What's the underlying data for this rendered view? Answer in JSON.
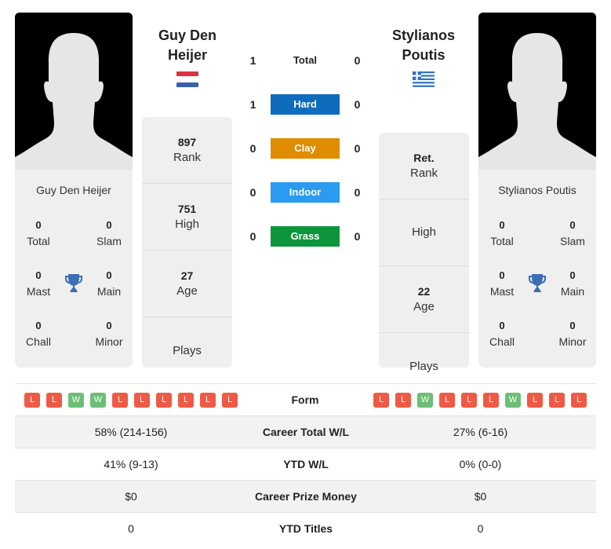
{
  "player1": {
    "name_line1": "Guy Den",
    "name_line2": "Heijer",
    "full_name": "Guy Den Heijer",
    "country_flag": "netherlands-flag",
    "info": [
      {
        "value": "897",
        "label": "Rank"
      },
      {
        "value": "751",
        "label": "High"
      },
      {
        "value": "27",
        "label": "Age"
      },
      {
        "value": "",
        "label": "Plays"
      }
    ],
    "titles": {
      "total": {
        "value": "0",
        "label": "Total"
      },
      "slam": {
        "value": "0",
        "label": "Slam"
      },
      "mast": {
        "value": "0",
        "label": "Mast"
      },
      "main": {
        "value": "0",
        "label": "Main"
      },
      "chall": {
        "value": "0",
        "label": "Chall"
      },
      "minor": {
        "value": "0",
        "label": "Minor"
      }
    },
    "form": [
      "L",
      "L",
      "W",
      "W",
      "L",
      "L",
      "L",
      "L",
      "L",
      "L"
    ]
  },
  "player2": {
    "name_line1": "Stylianos",
    "name_line2": "Poutis",
    "full_name": "Stylianos Poutis",
    "country_flag": "greece-flag",
    "info": [
      {
        "value": "Ret.",
        "label": "Rank"
      },
      {
        "value": "",
        "label": "High"
      },
      {
        "value": "22",
        "label": "Age"
      },
      {
        "value": "",
        "label": "Plays"
      }
    ],
    "titles": {
      "total": {
        "value": "0",
        "label": "Total"
      },
      "slam": {
        "value": "0",
        "label": "Slam"
      },
      "mast": {
        "value": "0",
        "label": "Mast"
      },
      "main": {
        "value": "0",
        "label": "Main"
      },
      "chall": {
        "value": "0",
        "label": "Chall"
      },
      "minor": {
        "value": "0",
        "label": "Minor"
      }
    },
    "form": [
      "L",
      "L",
      "W",
      "L",
      "L",
      "L",
      "W",
      "L",
      "L",
      "L"
    ]
  },
  "h2h": [
    {
      "label": "Total",
      "p1": "1",
      "p2": "0",
      "color": ""
    },
    {
      "label": "Hard",
      "p1": "1",
      "p2": "0",
      "color": "#0f6cbd"
    },
    {
      "label": "Clay",
      "p1": "0",
      "p2": "0",
      "color": "#df8c00"
    },
    {
      "label": "Indoor",
      "p1": "0",
      "p2": "0",
      "color": "#2a9bf0"
    },
    {
      "label": "Grass",
      "p1": "0",
      "p2": "0",
      "color": "#0d953b"
    }
  ],
  "form_label": "Form",
  "stats": [
    {
      "label": "Career Total W/L",
      "p1": "58% (214-156)",
      "p2": "27% (6-16)"
    },
    {
      "label": "YTD W/L",
      "p1": "41% (9-13)",
      "p2": "0% (0-0)"
    },
    {
      "label": "Career Prize Money",
      "p1": "$0",
      "p2": "$0"
    },
    {
      "label": "YTD Titles",
      "p1": "0",
      "p2": "0"
    }
  ],
  "colors": {
    "loss": "#ee5a45",
    "win": "#6cbf74",
    "trophy": "#3d6db5"
  }
}
